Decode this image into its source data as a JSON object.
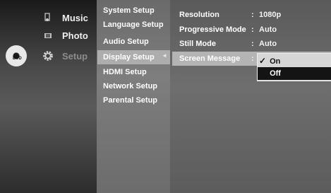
{
  "main_menu": {
    "items": [
      {
        "label": "Music",
        "icon": "music-note-icon"
      },
      {
        "label": "Photo",
        "icon": "photo-icon"
      },
      {
        "label": "Setup",
        "icon": "gear-icon",
        "active": true
      }
    ],
    "disc_label": "DVD"
  },
  "submenu": {
    "items": [
      {
        "label": "System Setup"
      },
      {
        "label": "Language Setup"
      },
      {
        "label": "Audio Setup"
      },
      {
        "label": "Display Setup",
        "selected": true
      },
      {
        "label": "HDMI Setup"
      },
      {
        "label": "Network Setup"
      },
      {
        "label": "Parental Setup"
      }
    ],
    "arrow": "◄"
  },
  "settings": {
    "rows": [
      {
        "label": "Resolution",
        "colon": ":",
        "value": "1080p"
      },
      {
        "label": "Progressive Mode",
        "colon": ":",
        "value": "Auto"
      },
      {
        "label": "Still Mode",
        "colon": ":",
        "value": "Auto"
      },
      {
        "label": "Screen Message",
        "colon": ":",
        "value": ""
      }
    ]
  },
  "popup": {
    "options": [
      {
        "label": "On",
        "checked": true,
        "check_glyph": "✓"
      },
      {
        "label": "Off",
        "highlighted": true,
        "check_glyph": ""
      }
    ]
  },
  "colors": {
    "submenu_highlight": "#adadad",
    "popup_bg": "#d6d6d6",
    "popup_selected": "#141414"
  }
}
